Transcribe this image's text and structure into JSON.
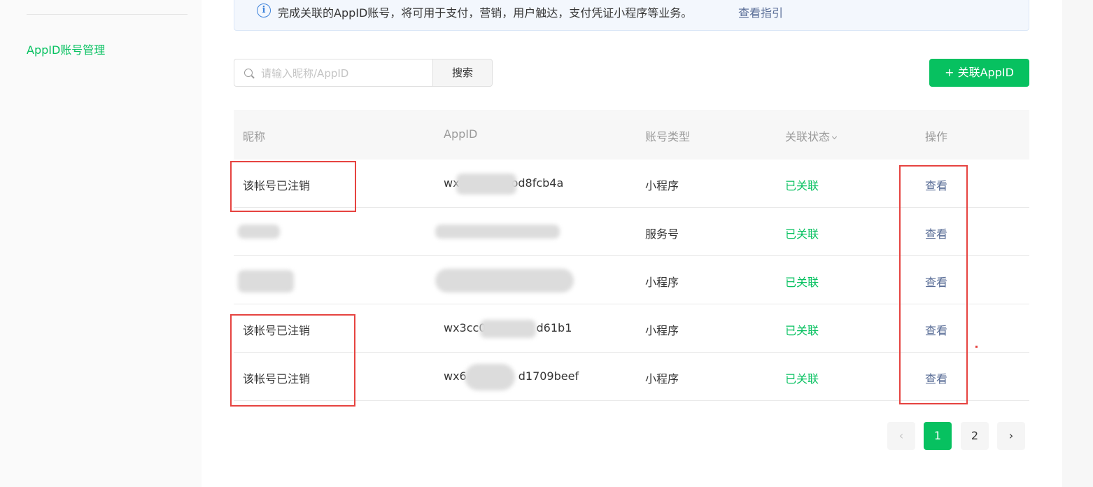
{
  "sidebar": {
    "items": [
      {
        "label": "AppID账号管理",
        "active": true
      }
    ]
  },
  "notice": {
    "icon": "info-circle-icon",
    "icon_glyph": "i",
    "text": "完成关联的AppID账号，将可用于支付，营销，用户触达，支付凭证小程序等业务。",
    "link": "查看指引"
  },
  "search": {
    "placeholder": "请输入昵称/AppID",
    "value": "",
    "button": "搜索"
  },
  "add_button": "+ 关联AppID",
  "table": {
    "columns": [
      "昵称",
      "AppID",
      "账号类型",
      "关联状态",
      "操作"
    ],
    "rows": [
      {
        "nickname": "该帐号已注销",
        "appid": "wx",
        "appid_tail": "od8fcb4a",
        "type": "小程序",
        "status": "已关联",
        "action": "查看"
      },
      {
        "nickname": "",
        "appid": "",
        "appid_tail": "",
        "type": "服务号",
        "status": "已关联",
        "action": "查看"
      },
      {
        "nickname": "",
        "appid": "",
        "appid_tail": "",
        "type": "小程序",
        "status": "已关联",
        "action": "查看"
      },
      {
        "nickname": "该帐号已注销",
        "appid": "wx3cc0",
        "appid_tail": "d61b1",
        "type": "小程序",
        "status": "已关联",
        "action": "查看"
      },
      {
        "nickname": "该帐号已注销",
        "appid": "wx6",
        "appid_tail": "d1709beef",
        "type": "小程序",
        "status": "已关联",
        "action": "查看"
      }
    ]
  },
  "pagination": {
    "prev": "‹",
    "pages": [
      "1",
      "2"
    ],
    "current": "1",
    "next": "›"
  },
  "colors": {
    "accent": "#07c160",
    "link": "#576b95",
    "annotation": "#e64340"
  }
}
